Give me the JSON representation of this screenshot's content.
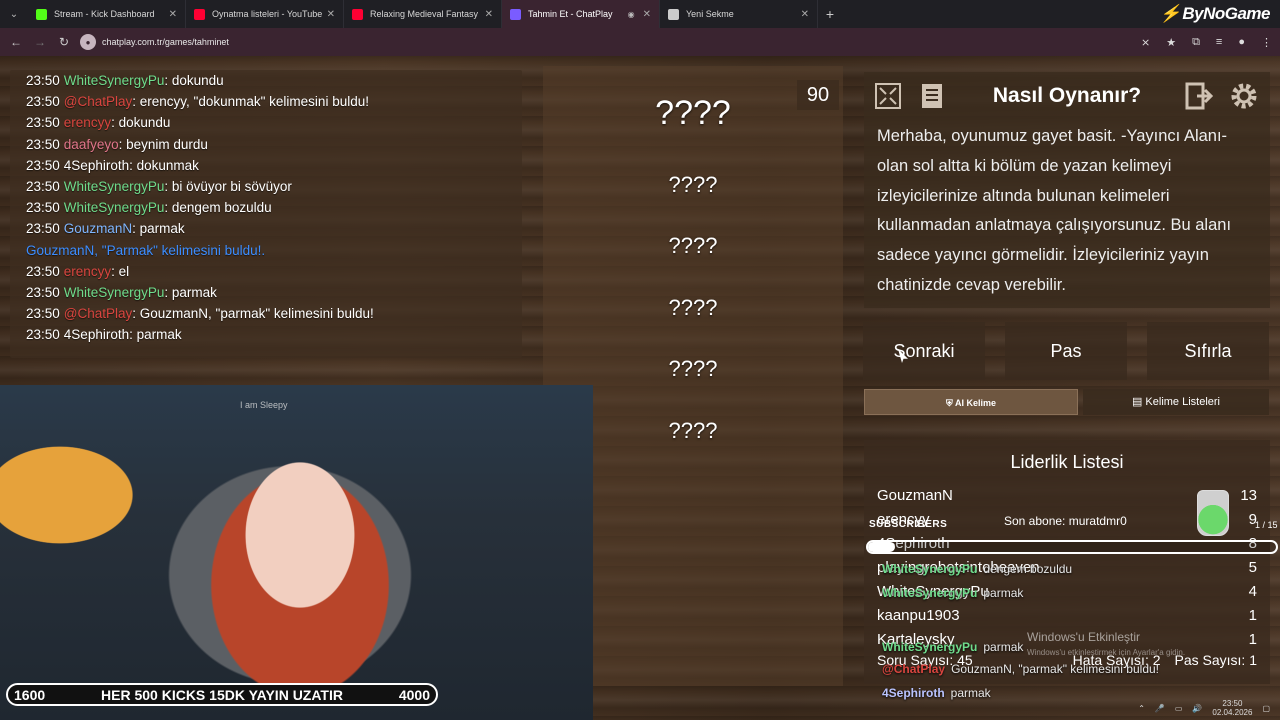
{
  "browser": {
    "tabs": [
      {
        "title": "Stream - Kick Dashboard",
        "color": "#53fc18",
        "active": false
      },
      {
        "title": "Oynatma listeleri - YouTube",
        "color": "#ff0033",
        "active": false
      },
      {
        "title": "Relaxing Medieval Fantasy",
        "color": "#ff0033",
        "active": false
      },
      {
        "title": "Tahmin Et - ChatPlay",
        "color": "#7a5cff",
        "active": true
      },
      {
        "title": "Yeni Sekme",
        "color": "#cccccc",
        "active": false
      }
    ],
    "url": "chatplay.com.tr/games/tahminet",
    "brand": "ByNoGame"
  },
  "chat": [
    {
      "time": "23:50",
      "user": "WhiteSynergyPu",
      "ucolor": "green",
      "msg": ": dokundu"
    },
    {
      "time": "23:50",
      "user": "@ChatPlay",
      "ucolor": "red",
      "msg": ": erencyy, \"dokunmak\" kelimesini buldu!"
    },
    {
      "time": "23:50",
      "user": "erencyy",
      "ucolor": "red",
      "msg": ": dokundu"
    },
    {
      "time": "23:50",
      "user": "daafyeyo",
      "ucolor": "pink",
      "msg": ": beynim durdu"
    },
    {
      "time": "23:50",
      "user": "4Sephiroth",
      "ucolor": "white",
      "msg": ": dokunmak"
    },
    {
      "time": "23:50",
      "user": "WhiteSynergyPu",
      "ucolor": "green",
      "msg": ": bi övüyor bi sövüyor"
    },
    {
      "time": "23:50",
      "user": "WhiteSynergyPu",
      "ucolor": "green",
      "msg": ": dengem bozuldu"
    },
    {
      "time": "23:50",
      "user": "GouzmanN",
      "ucolor": "blue",
      "msg": ": parmak"
    },
    {
      "time": "",
      "user": "",
      "ucolor": "",
      "msg": "GouzmanN, \"Parmak\" kelimesini buldu!.",
      "system": true
    },
    {
      "time": "23:50",
      "user": "erencyy",
      "ucolor": "red",
      "msg": ": el"
    },
    {
      "time": "23:50",
      "user": "WhiteSynergyPu",
      "ucolor": "green",
      "msg": ": parmak"
    },
    {
      "time": "23:50",
      "user": "@ChatPlay",
      "ucolor": "red",
      "msg": ": GouzmanN, \"parmak\" kelimesini buldu!"
    },
    {
      "time": "23:50",
      "user": "4Sephiroth",
      "ucolor": "white",
      "msg": ": parmak"
    }
  ],
  "game": {
    "timer": "90",
    "words": [
      "????",
      "????",
      "????",
      "????",
      "????",
      "????"
    ]
  },
  "info": {
    "title": "Nasıl Oynanır?",
    "text": "Merhaba, oyunumuz gayet basit. -Yayıncı Alanı- olan sol altta ki bölüm de yazan kelimeyi izleyicilerinize altında bulunan kelimeleri kullanmadan anlatmaya çalışıyorsunuz. Bu alanı sadece yayıncı görmelidir. İzleyicileriniz yayın chatinizde cevap verebilir."
  },
  "buttons": {
    "next": "Sonraki",
    "pass": "Pas",
    "reset": "Sıfırla",
    "ai_word": "AI Kelime",
    "word_lists": "Kelime Listeleri"
  },
  "leaderboard": {
    "title": "Liderlik Listesi",
    "rows": [
      {
        "name": "GouzmanN",
        "score": "13"
      },
      {
        "name": "erencyy",
        "score": "9"
      },
      {
        "name": "4Sephiroth",
        "score": "8"
      },
      {
        "name": "playingrobotsintoheaven",
        "score": "5"
      },
      {
        "name": "WhiteSynergyPu",
        "score": "4"
      },
      {
        "name": "kaanpu1903",
        "score": "1"
      },
      {
        "name": "Kartaleysky",
        "score": "1"
      }
    ],
    "question_count": "Soru Sayısı: 45",
    "error_count": "Hata Sayısı: 2",
    "pass_count": "Pas Sayısı: 1"
  },
  "overlay": {
    "subscribers_label": "SUBSCRIBERS",
    "last_sub": "Son abone: muratdmr0",
    "sub_count": "1 / 15",
    "sub_progress": 0.067,
    "kick_bar": {
      "left": "1600",
      "text": "HER 500 KICKS 15DK YAYIN UZATIR",
      "right": "4000"
    },
    "stream_chat": [
      {
        "user": "WhiteSynergyPu",
        "msg": "dengem bozuldu"
      },
      {
        "user": "WhiteSynergyPu",
        "msg": "parmak"
      },
      {
        "user": "WhiteSynergyPu",
        "msg": "parmak"
      },
      {
        "user": "@ChatPlay",
        "msg": "GouzmanN, \"parmak\" kelimesini buldu!"
      },
      {
        "user": "4Sephiroth",
        "msg": "parmak"
      }
    ],
    "windows_activate": "Windows'u Etkinleştir",
    "windows_activate_sub": "Windows'u etkinleştirmek için Ayarlar'a gidin.",
    "webcam_sign": "I am Sleepy"
  },
  "taskbar": {
    "time": "23:50",
    "date": "02.04.2026"
  }
}
